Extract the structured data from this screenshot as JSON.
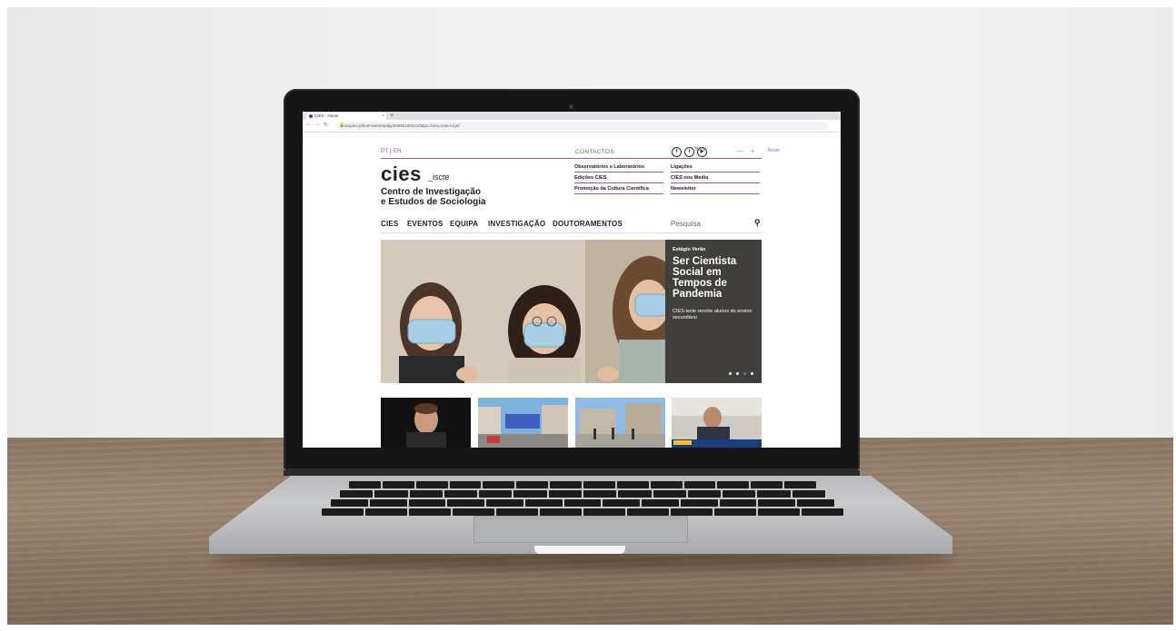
{
  "browser": {
    "tab_title": "CIES - Home",
    "tab_close": "×",
    "new_tab": "+",
    "url": "arquivo.pt/noFrame/replay/20092100021/https://cies.iscte-iul.pt/"
  },
  "top_bar": {
    "lang_pt": "PT",
    "lang_sep": " | ",
    "lang_en": "EN",
    "contactos": "CONTACTOS",
    "social": [
      {
        "icon": "facebook-icon",
        "glyph": "f"
      },
      {
        "icon": "twitter-icon",
        "glyph": "t"
      },
      {
        "icon": "youtube-icon",
        "glyph": "▶"
      }
    ],
    "accessibility_label": "3D",
    "accessibility_pct": "%",
    "zoom_out": "—",
    "zoom_in": "+",
    "reset": "Reset"
  },
  "brand": {
    "logo_main": "cies",
    "logo_sub": "_iscte",
    "org_line1": "Centro de Investigação",
    "org_line2": "e Estudos de Sociologia"
  },
  "quick_links": [
    "Observatórios e Laboratórios",
    "Ligações",
    "Edições CIES",
    "CIES nos Media",
    "Promoção da Cultura Científica",
    "Newsletter"
  ],
  "main_nav": [
    "CIES",
    "EVENTOS",
    "EQUIPA",
    "INVESTIGAÇÃO",
    "DOUTORAMENTOS"
  ],
  "search": {
    "label": "Pesquisa"
  },
  "hero": {
    "kicker": "Estágio Verão",
    "title": "Ser Cientista Social em Tempos de Pandemia",
    "description": "CIES-iscte recebe alunos do ensino secundário",
    "dots": 4,
    "active_dot": 2
  },
  "thumbnails": [
    "news-thumb-1",
    "news-thumb-2",
    "news-thumb-3",
    "news-thumb-4"
  ],
  "colors": {
    "accent": "#9b59b6",
    "overlay": "#262626"
  }
}
